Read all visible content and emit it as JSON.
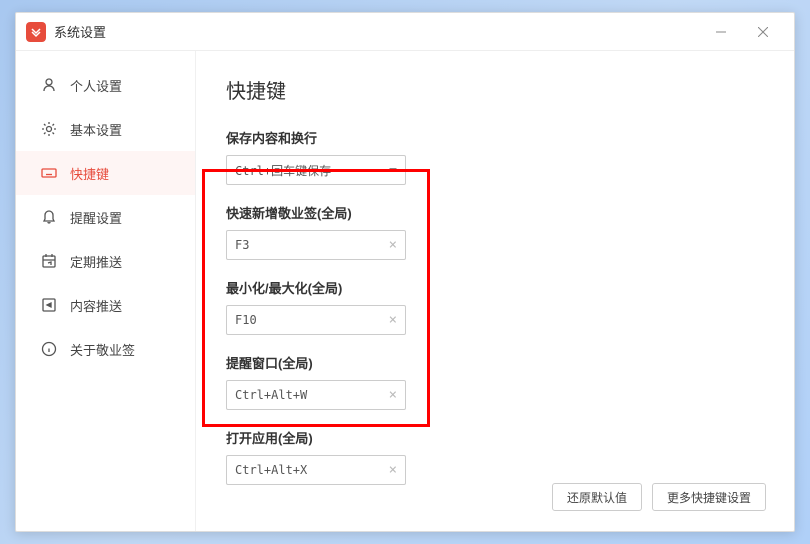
{
  "window": {
    "title": "系统设置"
  },
  "sidebar": {
    "items": [
      {
        "label": "个人设置"
      },
      {
        "label": "基本设置"
      },
      {
        "label": "快捷键"
      },
      {
        "label": "提醒设置"
      },
      {
        "label": "定期推送"
      },
      {
        "label": "内容推送"
      },
      {
        "label": "关于敬业签"
      }
    ]
  },
  "main": {
    "title": "快捷键",
    "save_section": {
      "label": "保存内容和换行",
      "value": "Ctrl+回车键保存"
    },
    "shortcuts": [
      {
        "label": "快速新增敬业签(全局)",
        "value": "F3"
      },
      {
        "label": "最小化/最大化(全局)",
        "value": "F10"
      },
      {
        "label": "提醒窗口(全局)",
        "value": "Ctrl+Alt+W"
      },
      {
        "label": "打开应用(全局)",
        "value": "Ctrl+Alt+X"
      }
    ],
    "footer": {
      "restore": "还原默认值",
      "more": "更多快捷键设置"
    }
  }
}
